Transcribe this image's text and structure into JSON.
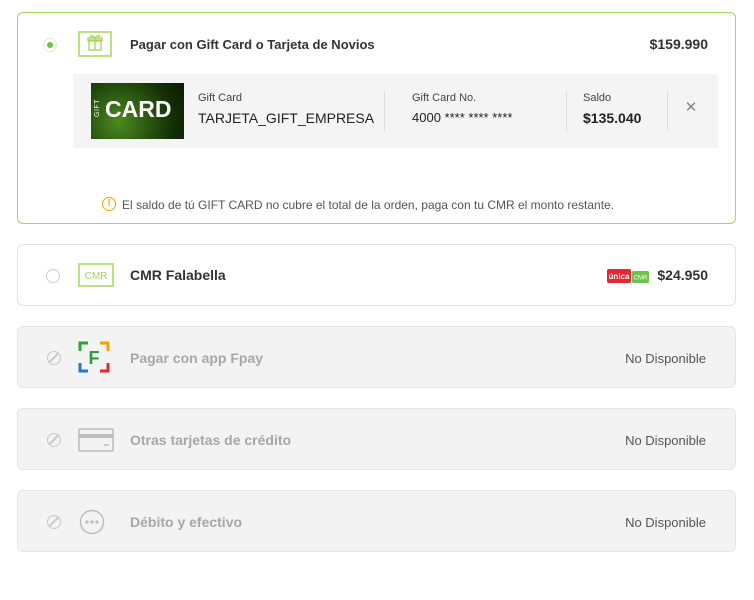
{
  "giftcard_option": {
    "title": "Pagar con Gift Card o Tarjeta de Novios",
    "price": "$159.990",
    "card": {
      "image_text": "CARD",
      "image_side_text": "GIFT",
      "type_label": "Gift Card",
      "type_value": "TARJETA_GIFT_EMPRESA",
      "number_label": "Gift Card No.",
      "number_value": "4000 **** **** ****",
      "balance_label": "Saldo",
      "balance_value": "$135.040",
      "remove_icon": "close-icon"
    },
    "warning": "El saldo de tú GIFT CARD no cubre el total de la orden, paga con tu CMR el monto restante.",
    "icon": "gift-icon"
  },
  "cmr_option": {
    "title": "CMR Falabella",
    "icon_text": "CMR",
    "badge_unica": "única",
    "badge_cmr": "CMR",
    "price": "$24.950"
  },
  "fpay_option": {
    "title": "Pagar con app Fpay",
    "icon_text": "F",
    "status": "No Disponible"
  },
  "credit_option": {
    "title": "Otras tarjetas de crédito",
    "status": "No Disponible"
  },
  "debit_option": {
    "title": "Débito y efectivo",
    "status": "No Disponible"
  },
  "colors": {
    "accent_green": "#a5d65a",
    "radio_green": "#6cc24a",
    "warning": "#f0a500",
    "unica_red": "#e3262f"
  }
}
